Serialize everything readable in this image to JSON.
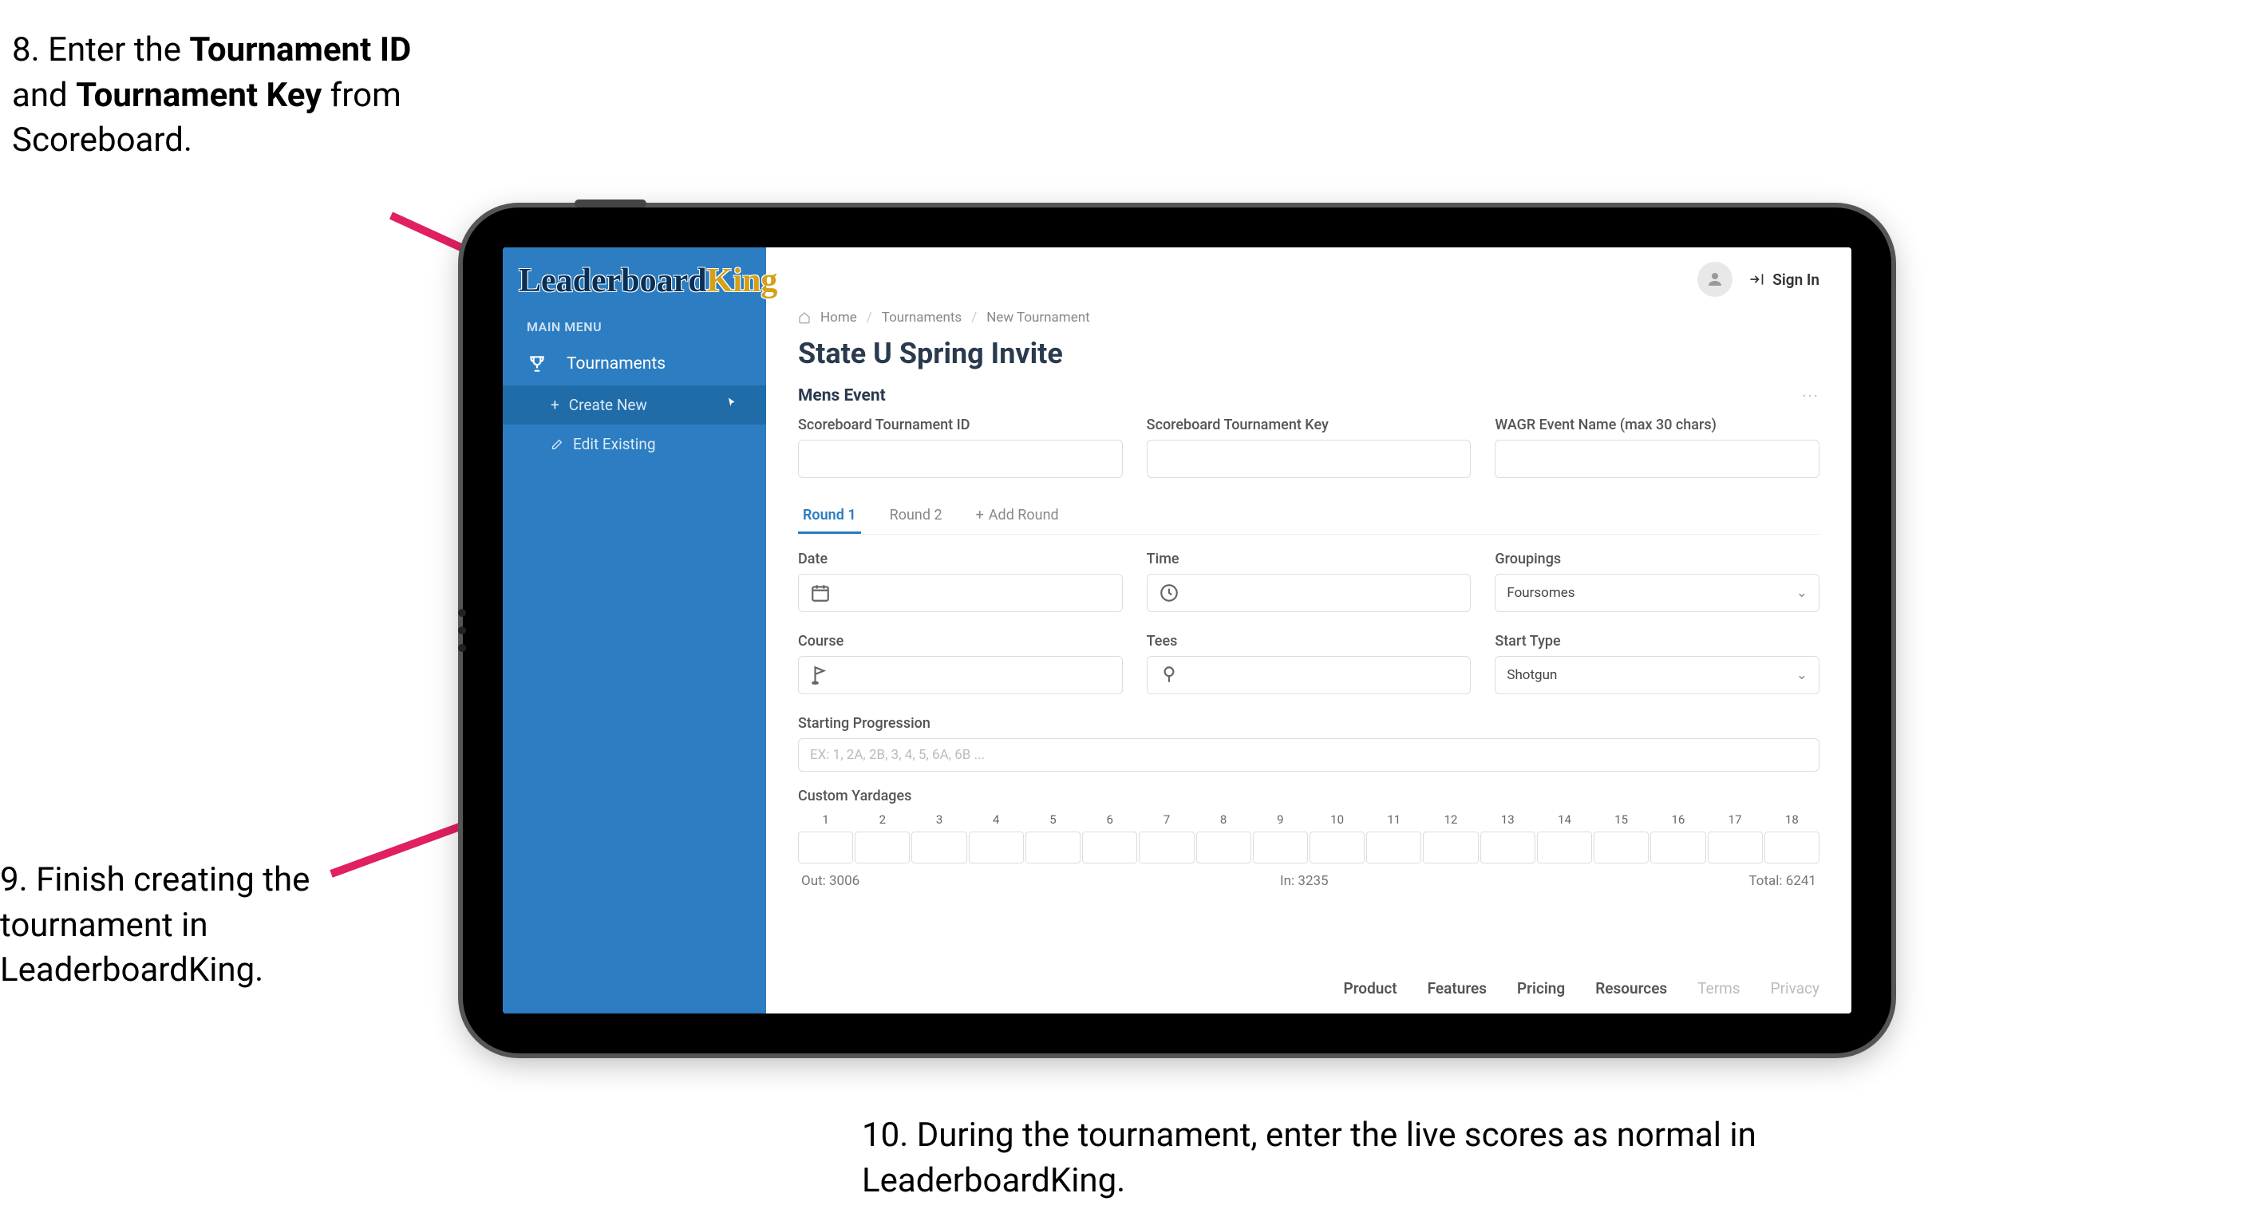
{
  "steps": {
    "s8_pre": "8. Enter the ",
    "s8_b1": "Tournament ID",
    "s8_mid": " and ",
    "s8_b2": "Tournament Key",
    "s8_post": " from Scoreboard.",
    "s9": "9. Finish creating the tournament in LeaderboardKing.",
    "s10": "10. During the tournament, enter the live scores as normal in LeaderboardKing."
  },
  "sidebar": {
    "logo_main": "Leaderboard",
    "logo_k": "King",
    "main_menu": "MAIN MENU",
    "tournaments": "Tournaments",
    "create_new": "Create New",
    "edit_existing": "Edit Existing"
  },
  "topbar": {
    "signin": "Sign In"
  },
  "breadcrumb": {
    "home": "Home",
    "tournaments": "Tournaments",
    "new": "New Tournament"
  },
  "page_title": "State U Spring Invite",
  "event_name": "Mens Event",
  "fields": {
    "tourn_id": "Scoreboard Tournament ID",
    "tourn_key": "Scoreboard Tournament Key",
    "wagr": "WAGR Event Name (max 30 chars)",
    "date": "Date",
    "time": "Time",
    "groupings": "Groupings",
    "groupings_val": "Foursomes",
    "course": "Course",
    "tees": "Tees",
    "start_type": "Start Type",
    "start_type_val": "Shotgun",
    "starting_prog": "Starting Progression",
    "starting_prog_ph": "EX: 1, 2A, 2B, 3, 4, 5, 6A, 6B ...",
    "custom_yardages": "Custom Yardages"
  },
  "tabs": {
    "r1": "Round 1",
    "r2": "Round 2",
    "add": "Add Round"
  },
  "holes": [
    "1",
    "2",
    "3",
    "4",
    "5",
    "6",
    "7",
    "8",
    "9",
    "10",
    "11",
    "12",
    "13",
    "14",
    "15",
    "16",
    "17",
    "18"
  ],
  "yardage_totals": {
    "out": "Out: 3006",
    "in": "In: 3235",
    "total": "Total: 6241"
  },
  "footer": {
    "product": "Product",
    "features": "Features",
    "pricing": "Pricing",
    "resources": "Resources",
    "terms": "Terms",
    "privacy": "Privacy"
  }
}
